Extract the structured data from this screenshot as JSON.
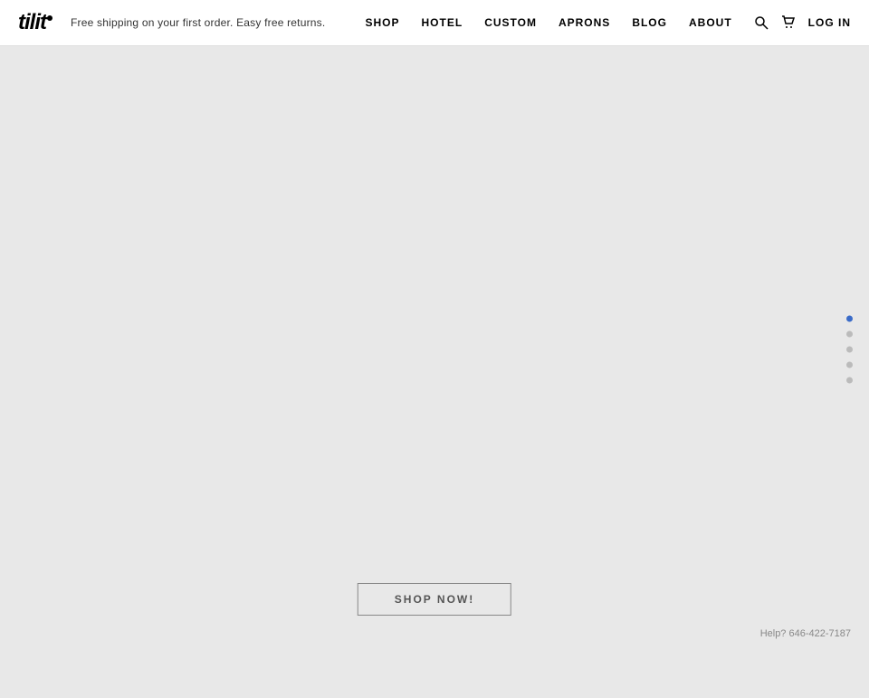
{
  "header": {
    "logo_text": "tilit",
    "tagline": "Free shipping on your first order. Easy free returns.",
    "nav": {
      "items": [
        {
          "label": "SHOP",
          "id": "shop"
        },
        {
          "label": "HOTEL",
          "id": "hotel"
        },
        {
          "label": "CUSTOM",
          "id": "custom"
        },
        {
          "label": "APRONS",
          "id": "aprons"
        },
        {
          "label": "BLOG",
          "id": "blog"
        },
        {
          "label": "ABOUT",
          "id": "about"
        }
      ],
      "login_label": "LOG IN"
    }
  },
  "slide_indicators": {
    "dots": [
      {
        "active": true
      },
      {
        "active": false
      },
      {
        "active": false
      },
      {
        "active": false
      },
      {
        "active": false
      }
    ]
  },
  "cta": {
    "button_label": "SHOP NOW!"
  },
  "footer": {
    "help_text": "Help? 646-422-7187"
  }
}
